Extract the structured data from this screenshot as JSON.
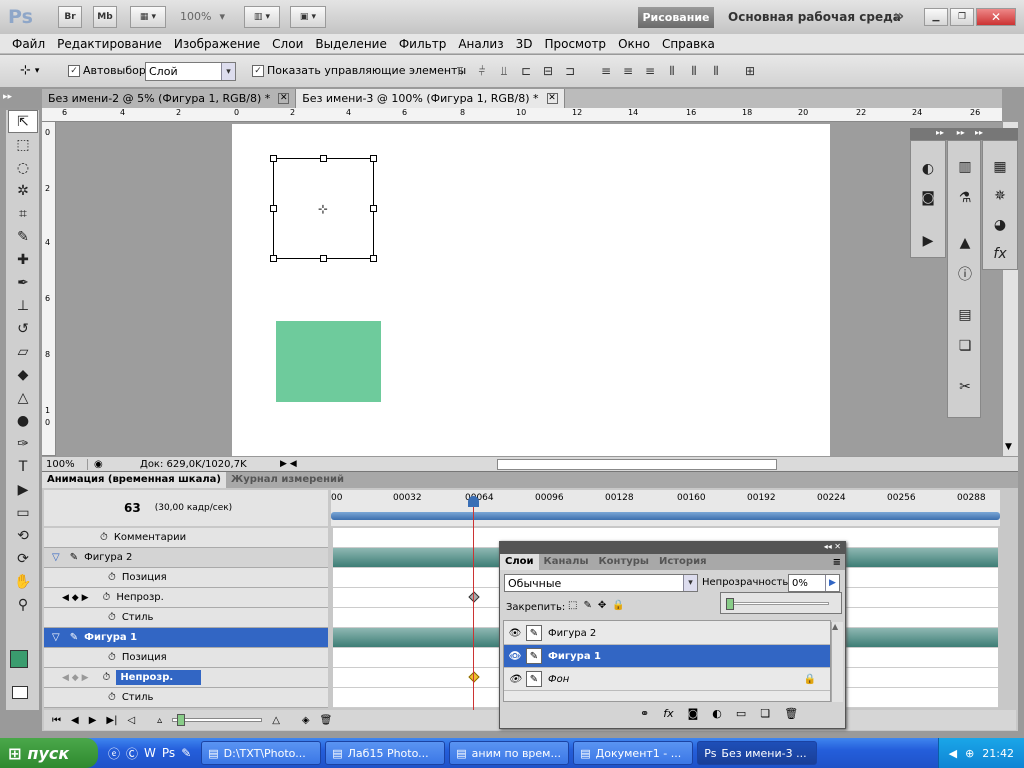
{
  "appbar": {
    "logo": "Ps",
    "bridge": "Br",
    "mini_bridge": "Mb",
    "zoom": "100%",
    "workspace_active": "Рисование",
    "workspace_main": "Основная рабочая среда",
    "more": "»"
  },
  "menu": [
    "Файл",
    "Редактирование",
    "Изображение",
    "Слои",
    "Выделение",
    "Фильтр",
    "Анализ",
    "3D",
    "Просмотр",
    "Окно",
    "Справка"
  ],
  "options": {
    "auto_select_label": "Автовыбор:",
    "auto_select_value": "Слой",
    "show_controls_label": "Показать управляющие элементы"
  },
  "docs": [
    {
      "title": "Без имени-2 @ 5% (Фигура 1, RGB/8) *"
    },
    {
      "title": "Без имени-3 @ 100% (Фигура 1, RGB/8) *"
    }
  ],
  "ruler": {
    "h": [
      "6",
      "4",
      "2",
      "0",
      "2",
      "4",
      "6",
      "8",
      "10",
      "12",
      "14",
      "16",
      "18",
      "20",
      "22",
      "24",
      "26"
    ],
    "v": [
      "0",
      "2",
      "4",
      "6",
      "8",
      "1",
      "0"
    ]
  },
  "status": {
    "zoom": "100%",
    "doc": "Док: 629,0K/1020,7K"
  },
  "timeline": {
    "tab1": "Анимация (временная шкала)",
    "tab2": "Журнал измерений",
    "frame": "63",
    "fps": "(30,00 кадр/сек)",
    "ticks": [
      "00",
      "00032",
      "00064",
      "00096",
      "00128",
      "00160",
      "00192",
      "00224",
      "00256",
      "00288"
    ],
    "rows": [
      {
        "label": "Комментарии"
      },
      {
        "label": "Фигура 2"
      },
      {
        "label": "Позиция"
      },
      {
        "label": "Непрозр."
      },
      {
        "label": "Стиль"
      },
      {
        "label": "Фигура 1"
      },
      {
        "label": "Позиция"
      },
      {
        "label": "Непрозр."
      },
      {
        "label": "Стиль"
      }
    ]
  },
  "layers": {
    "tabs": [
      "Слои",
      "Каналы",
      "Контуры",
      "История"
    ],
    "blend": "Обычные",
    "opacity_label": "Непрозрачность:",
    "opacity_value": "0%",
    "opacity_fill": 0,
    "lock_label": "Закрепить:",
    "items": [
      {
        "name": "Фигура 2"
      },
      {
        "name": "Фигура 1"
      },
      {
        "name": "Фон"
      }
    ]
  },
  "taskbar": {
    "start": "пуск",
    "tasks": [
      "D:\\TXT\\Photo...",
      "Лаб15 Photo...",
      "аним по врем...",
      "Документ1 - ...",
      "Без имени-3 ..."
    ],
    "clock": "21:42"
  },
  "colors": {
    "shape": "#6ecb9c",
    "accent": "#3266c4"
  }
}
